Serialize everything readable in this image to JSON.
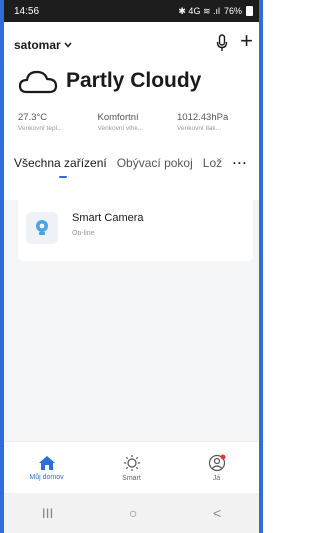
{
  "status": {
    "time": "14:56",
    "signal_text": "4G LTE",
    "battery": "76%"
  },
  "header": {
    "home_name": "satomar",
    "mic_icon": "mic-icon",
    "add_icon": "plus-icon"
  },
  "weather": {
    "condition": "Partly Cloudy",
    "icon": "cloud-icon",
    "stats": [
      {
        "value": "27.3°C",
        "label": "Venkovní tepl..."
      },
      {
        "value": "Komfortní",
        "label": "Venkovní vlhk..."
      },
      {
        "value": "1012.43hPa",
        "label": "Venkovní tlak..."
      }
    ]
  },
  "tabs": [
    {
      "label": "Všechna zařízení"
    },
    {
      "label": "Obývací pokoj"
    },
    {
      "label": "Lož"
    }
  ],
  "more_label": "···",
  "devices": [
    {
      "name": "Smart Camera",
      "status": "On-line"
    }
  ],
  "bottom_nav": [
    {
      "label": "Můj domov"
    },
    {
      "label": "Smart"
    },
    {
      "label": "Já"
    }
  ],
  "colors": {
    "accent": "#2d6fd6",
    "badge": "#e53935"
  },
  "system_nav": {
    "recents": "III",
    "home": "○",
    "back": "<"
  }
}
